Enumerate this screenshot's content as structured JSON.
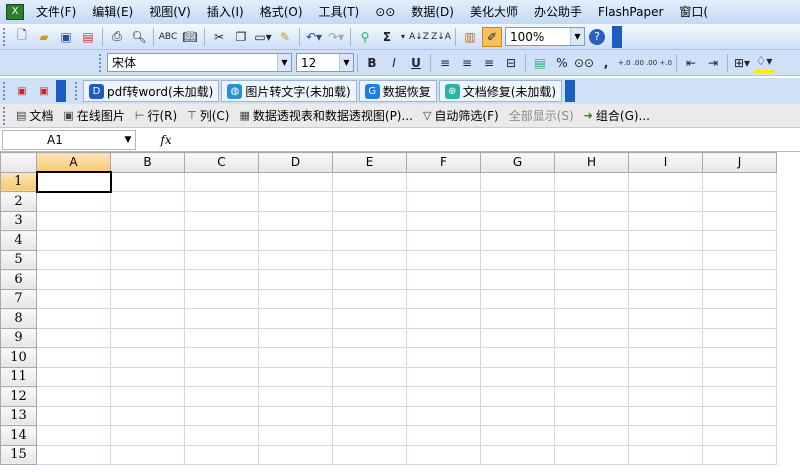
{
  "menubar": {
    "items": [
      "文件(F)",
      "编辑(E)",
      "视图(V)",
      "插入(I)",
      "格式(O)",
      "工具(T)",
      "数据(D)",
      "美化大师",
      "办公助手",
      "FlashPaper",
      "窗口("
    ]
  },
  "toolbar1": {
    "zoom": "100%",
    "icons": [
      "new",
      "open",
      "save",
      "permission",
      "print",
      "print-preview",
      "spelling",
      "research",
      "cut",
      "copy",
      "paste",
      "format-painter",
      "undo",
      "redo",
      "hyperlink",
      "autosum",
      "sort-asc",
      "sort-desc",
      "chart",
      "drawing",
      "help"
    ],
    "autosum": "Σ"
  },
  "toolbar2": {
    "font": "宋体",
    "size": "12",
    "bold": "B",
    "italic": "I",
    "underline": "U",
    "percent": "%",
    "comma": ",",
    "inc_decimal": "+.0 .00",
    "dec_decimal": ".00 +.0"
  },
  "toolbar3": {
    "plugins": [
      "pdf转word(未加载)",
      "图片转文字(未加载)",
      "数据恢复",
      "文档修复(未加载)"
    ],
    "plugin_colors": [
      "#1d5cc1",
      "#2b8fd6",
      "#1f7fe0",
      "#2bb3a0"
    ]
  },
  "toolbar4": {
    "items": [
      "文档",
      "在线图片",
      "行(R)",
      "列(C)",
      "数据透视表和数据透视图(P)...",
      "自动筛选(F)",
      "全部显示(S)",
      "组合(G)..."
    ]
  },
  "formula": {
    "namebox": "A1",
    "fx": "fx",
    "content": ""
  },
  "sheet": {
    "columns": [
      "A",
      "B",
      "C",
      "D",
      "E",
      "F",
      "G",
      "H",
      "I",
      "J"
    ],
    "rows": [
      "1",
      "2",
      "3",
      "4",
      "5",
      "6",
      "7",
      "8",
      "9",
      "10",
      "11",
      "12",
      "13",
      "14",
      "15"
    ],
    "active_cell": "A1"
  }
}
